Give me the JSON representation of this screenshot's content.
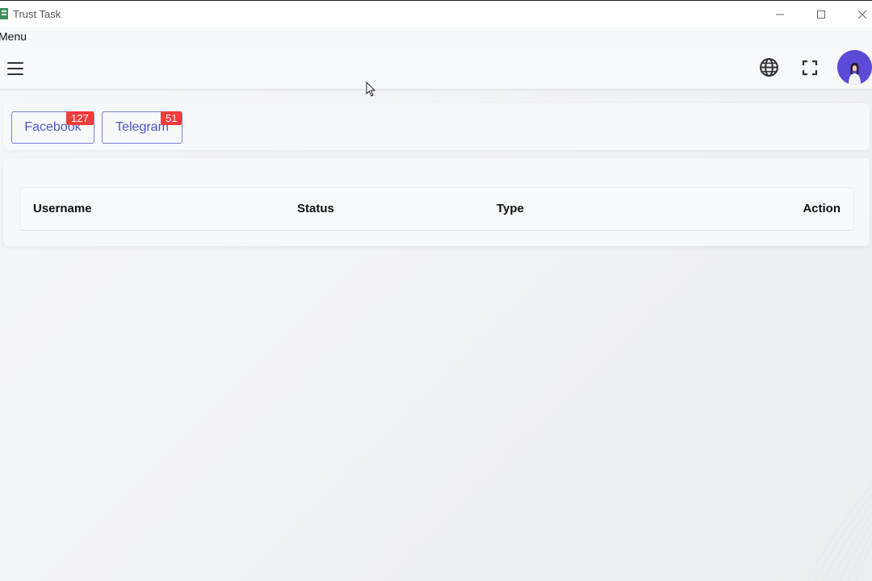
{
  "window": {
    "title": "Trust Task"
  },
  "menubar": {
    "menu_label": "Menu"
  },
  "header": {
    "icons": [
      "hamburger-menu-icon",
      "globe-icon",
      "fullscreen-icon",
      "avatar"
    ]
  },
  "channels": [
    {
      "label": "Facebook",
      "count": "127"
    },
    {
      "label": "Telegram",
      "count": "51"
    }
  ],
  "table": {
    "columns": [
      "Username",
      "Status",
      "Type",
      "Action"
    ]
  },
  "colors": {
    "accent": "#4f55c7",
    "badge": "#f23b3b",
    "avatar_bg": "#5b4bd6"
  }
}
